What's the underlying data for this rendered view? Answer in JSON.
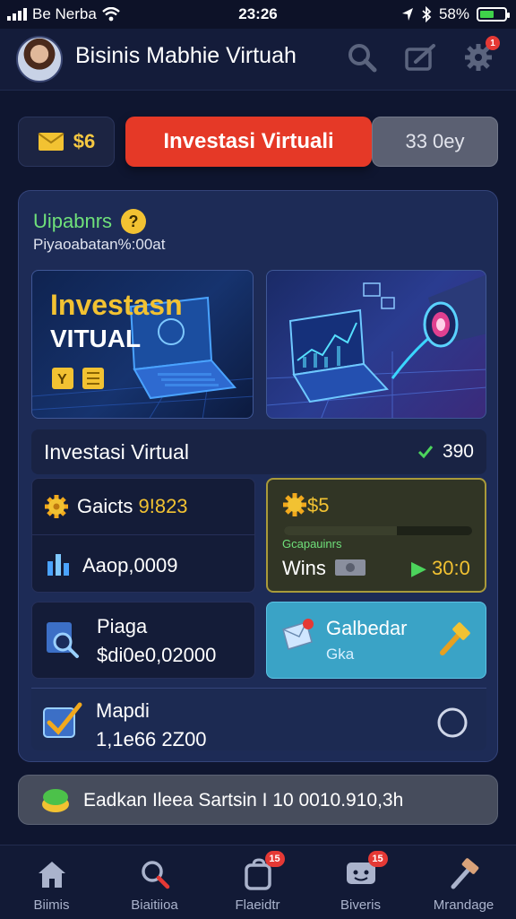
{
  "status_bar": {
    "carrier": "Be Nerba",
    "time": "23:26",
    "battery": "58%",
    "battery_level": 0.58
  },
  "header": {
    "title": "Bisinis Mabhie Virtuah",
    "settings_badge": "1",
    "icons": [
      "search-icon",
      "edit-icon",
      "gear-icon"
    ]
  },
  "top_row": {
    "coin_value": "$6",
    "invest_button": "Investasi Virtuali",
    "days_button": "33 0ey"
  },
  "card": {
    "title": "Uipabnrs",
    "help_icon": "?",
    "subtitle": "Piyaoabatan%:00at",
    "banner_line1": "Investasn",
    "banner_line2": "VITUAL",
    "info_label": "Investasi Virtual",
    "info_value": "390",
    "stats_line1": "Gaicts",
    "stats_value1": "9!823",
    "stats_line2": "Aaop,0009",
    "gold_title": "$5",
    "gold_caption": "Gcapauinrs",
    "gold_wins_label": "Wins",
    "gold_wins_value": "30:0",
    "gold_progress": 0.6,
    "plaga_title": "Piaga",
    "plaga_value": "$di0e0,02000",
    "cyan_title": "Galbedar",
    "cyan_sub": "Gka",
    "wide_title": "Mapdi",
    "wide_value": "1,1e66 2Z00"
  },
  "bottom_banner": {
    "text": "Eadkan Ileea Sartsin I 10 0010.910,3h"
  },
  "tabs": [
    {
      "label": "Biimis",
      "icon": "home-icon",
      "badge": ""
    },
    {
      "label": "Biaitiioa",
      "icon": "search-icon",
      "badge": ""
    },
    {
      "label": "Flaeidtr",
      "icon": "shop-icon",
      "badge": "15"
    },
    {
      "label": "Biveris",
      "icon": "chat-icon",
      "badge": "15"
    },
    {
      "label": "Mrandage",
      "icon": "hammer-icon",
      "badge": ""
    }
  ],
  "colors": {
    "accent_red": "#e53927",
    "accent_green": "#6fe07a",
    "gold": "#f2c232",
    "cyan_tile": "#3aa3c6"
  }
}
